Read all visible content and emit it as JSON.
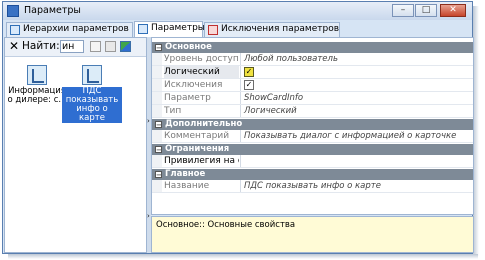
{
  "window": {
    "title": "Параметры",
    "buttons": {
      "minimize": "–",
      "maximize": "□",
      "close": "✕"
    }
  },
  "tabs": [
    {
      "label": "Иерархии параметров"
    },
    {
      "label": "Параметры"
    },
    {
      "label": "Исключения параметров"
    }
  ],
  "toolbar": {
    "close_glyph": "✕",
    "find_label": "Найти:",
    "find_value": "ин"
  },
  "items": [
    {
      "label": "Информация о дилере: с..."
    },
    {
      "label": "ПДС показывать инфо о карте"
    }
  ],
  "grid": {
    "sections": [
      {
        "title": "Основное",
        "rows": [
          {
            "name": "Уровень доступа",
            "value": "Любой пользователь"
          },
          {
            "name": "Логический",
            "value": "✓"
          },
          {
            "name": "Исключения",
            "value": "✓"
          },
          {
            "name": "Параметр",
            "value": "ShowCardInfo"
          },
          {
            "name": "Тип",
            "value": "Логический"
          }
        ]
      },
      {
        "title": "Дополнительно",
        "rows": [
          {
            "name": "Комментарий",
            "value": "Показывать диалог с информацией о карточке"
          }
        ]
      },
      {
        "title": "Ограничения",
        "rows": [
          {
            "name": "Привилегия на объе",
            "value": ""
          }
        ]
      },
      {
        "title": "Главное",
        "rows": [
          {
            "name": "Название",
            "value": "ПДС показывать инфо о карте"
          }
        ]
      }
    ],
    "expand_glyph": "−"
  },
  "description": "Основное:: Основные свойства",
  "colors": {
    "selection": "#2f6ed1",
    "section_header": "#7e8a97",
    "description_bg": "#fffbd6",
    "checkbox_highlight": "#f0e240"
  }
}
